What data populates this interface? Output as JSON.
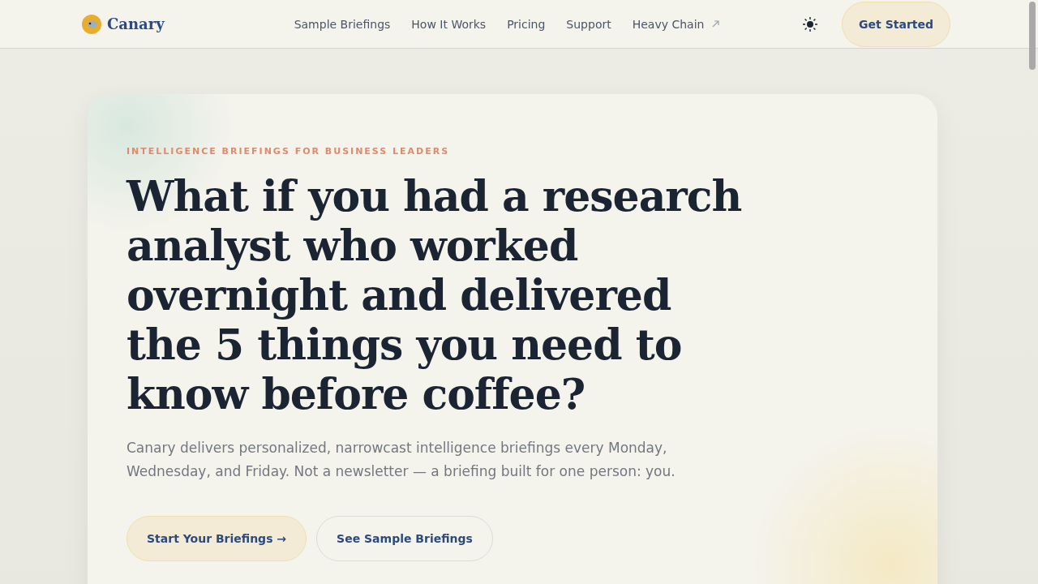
{
  "header": {
    "brand": "Canary",
    "nav": [
      {
        "label": "Sample Briefings",
        "external": false
      },
      {
        "label": "How It Works",
        "external": false
      },
      {
        "label": "Pricing",
        "external": false
      },
      {
        "label": "Support",
        "external": false
      },
      {
        "label": "Heavy Chain",
        "external": true
      }
    ],
    "cta": "Get Started"
  },
  "hero": {
    "eyebrow": "INTELLIGENCE BRIEFINGS FOR BUSINESS LEADERS",
    "headline": "What if you had a research analyst who worked overnight and delivered the 5 things you need to know before coffee?",
    "lead": "Canary delivers personalized, narrowcast intelligence briefings every Monday, Wednesday, and Friday. Not a newsletter — a briefing built for one person: you.",
    "buttons": [
      {
        "label": "Start Your Briefings →",
        "kind": "primary"
      },
      {
        "label": "See Sample Briefings",
        "kind": "secondary"
      }
    ]
  }
}
